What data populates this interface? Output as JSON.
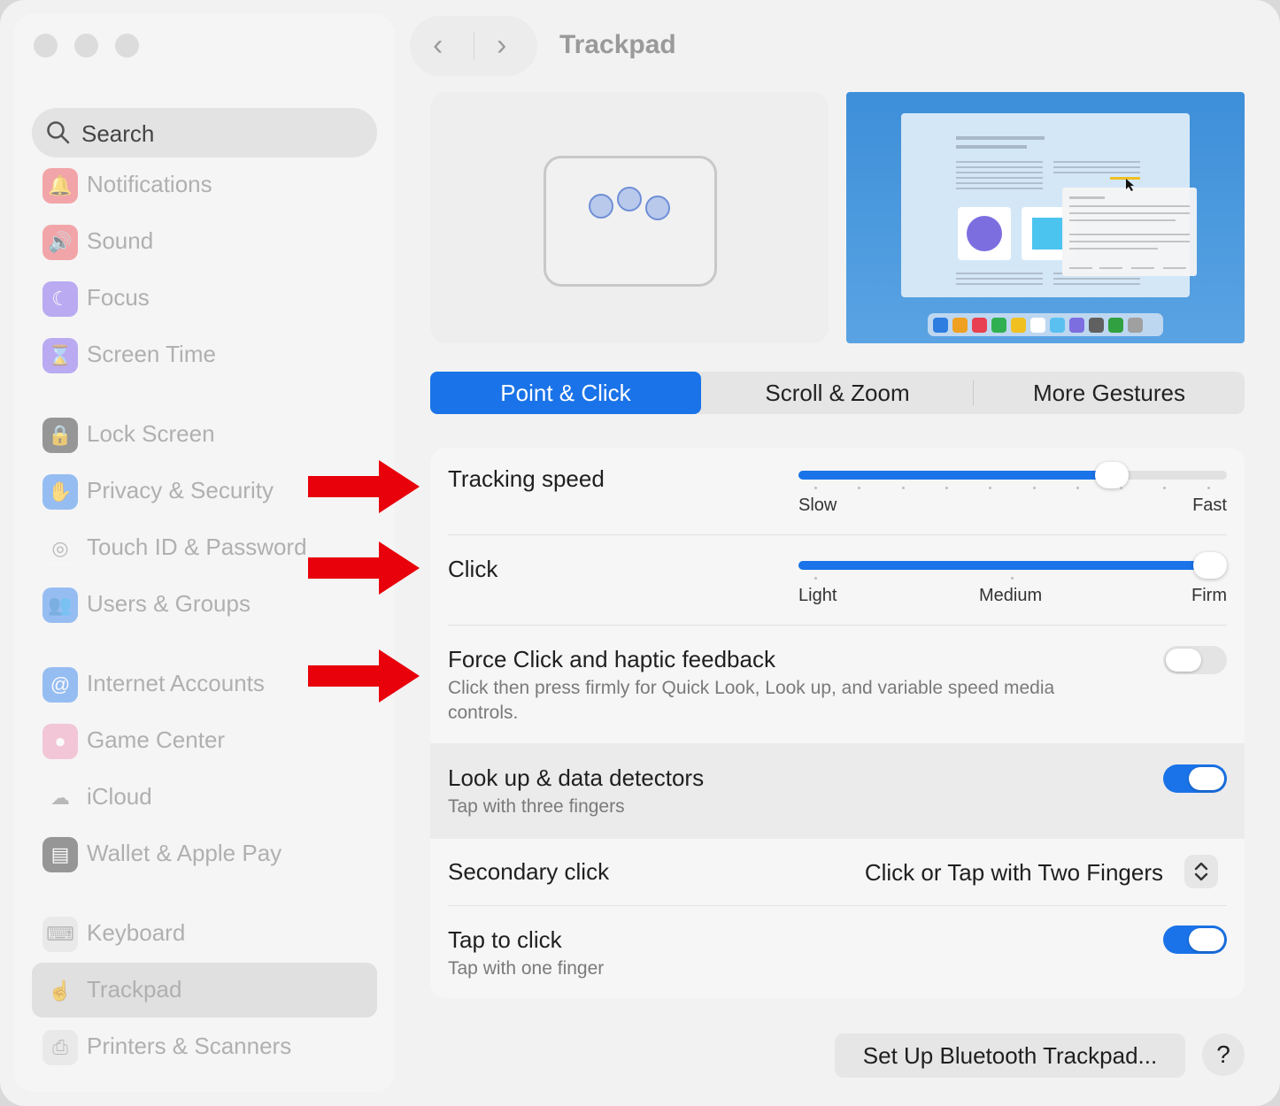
{
  "window": {
    "title": "Trackpad"
  },
  "sidebar": {
    "search_placeholder": "Search",
    "items": [
      {
        "label": "Notifications",
        "icon": "bell-icon",
        "color": "#f0646a"
      },
      {
        "label": "Sound",
        "icon": "speaker-icon",
        "color": "#f0646a"
      },
      {
        "label": "Focus",
        "icon": "moon-icon",
        "color": "#8a6ef0"
      },
      {
        "label": "Screen Time",
        "icon": "hourglass-icon",
        "color": "#8a6ef0"
      },
      {
        "label": "Lock Screen",
        "icon": "lock-icon",
        "color": "#4a4a4a"
      },
      {
        "label": "Privacy & Security",
        "icon": "hand-icon",
        "color": "#4a90f0"
      },
      {
        "label": "Touch ID & Password",
        "icon": "fingerprint-icon",
        "color": "#f5f5f5"
      },
      {
        "label": "Users & Groups",
        "icon": "users-icon",
        "color": "#4a90f0"
      },
      {
        "label": "Internet Accounts",
        "icon": "at-icon",
        "color": "#4a90f0"
      },
      {
        "label": "Game Center",
        "icon": "game-center-icon",
        "color": "#f0a0c0"
      },
      {
        "label": "iCloud",
        "icon": "cloud-icon",
        "color": "#f5f5f5"
      },
      {
        "label": "Wallet & Apple Pay",
        "icon": "wallet-icon",
        "color": "#4a4a4a"
      },
      {
        "label": "Keyboard",
        "icon": "keyboard-icon",
        "color": "#e0e0e0"
      },
      {
        "label": "Trackpad",
        "icon": "trackpad-icon",
        "color": "#e0e0e0",
        "selected": true
      },
      {
        "label": "Printers & Scanners",
        "icon": "printer-icon",
        "color": "#e0e0e0"
      }
    ]
  },
  "tabs": [
    "Point & Click",
    "Scroll & Zoom",
    "More Gestures"
  ],
  "active_tab": "Point & Click",
  "settings": {
    "tracking_speed": {
      "label": "Tracking speed",
      "min_label": "Slow",
      "max_label": "Fast",
      "value": 0.75
    },
    "click": {
      "label": "Click",
      "labels": [
        "Light",
        "Medium",
        "Firm"
      ],
      "value": 1.0
    },
    "force_click": {
      "label": "Force Click and haptic feedback",
      "description": "Click then press firmly for Quick Look, Look up, and variable speed media controls.",
      "on": false
    },
    "look_up": {
      "label": "Look up & data detectors",
      "description": "Tap with three fingers",
      "on": true
    },
    "secondary_click": {
      "label": "Secondary click",
      "value": "Click or Tap with Two Fingers"
    },
    "tap_to_click": {
      "label": "Tap to click",
      "description": "Tap with one finger",
      "on": true
    }
  },
  "footer": {
    "setup_button": "Set Up Bluetooth Trackpad...",
    "help_button": "?"
  },
  "accent_color": "#1a73e8",
  "annotation_color": "#e8000b"
}
